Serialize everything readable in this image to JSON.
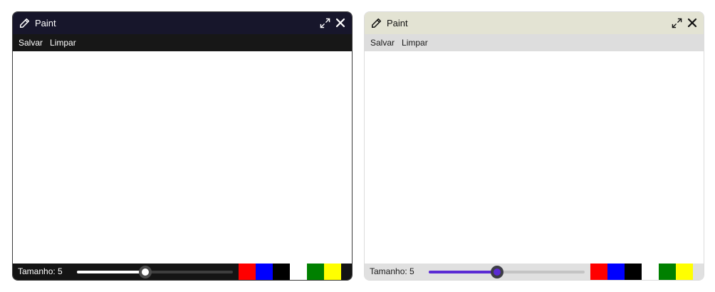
{
  "windows": [
    {
      "theme": "dark",
      "title": "Paint",
      "menu": [
        "Salvar",
        "Limpar"
      ],
      "size_label": "Tamanho: 5",
      "slider": {
        "min": 1,
        "max": 20,
        "value": 5,
        "fraction": 0.44
      },
      "accent": "#ffffff"
    },
    {
      "theme": "light",
      "title": "Paint",
      "menu": [
        "Salvar",
        "Limpar"
      ],
      "size_label": "Tamanho: 5",
      "slider": {
        "min": 1,
        "max": 20,
        "value": 5,
        "fraction": 0.44
      },
      "accent": "#5b2bd4"
    }
  ],
  "palette": [
    "#ff0000",
    "#0000ff",
    "#000000",
    "#ffffff",
    "#008000",
    "#ffff00"
  ],
  "icons": {
    "app": "pencil-icon",
    "maximize": "maximize-icon",
    "close": "close-icon"
  }
}
